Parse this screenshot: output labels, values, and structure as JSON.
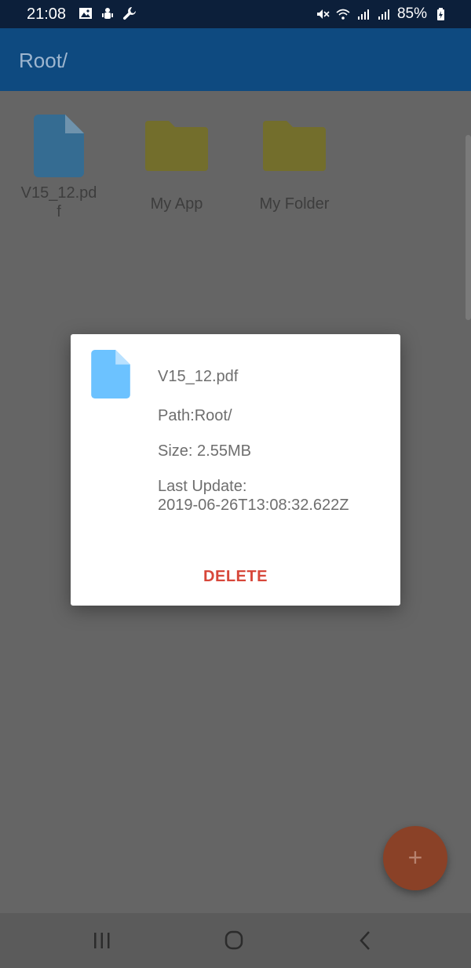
{
  "status_bar": {
    "time": "21:08",
    "battery": "85%",
    "left_icons": [
      "image-icon",
      "android-debug-icon",
      "wrench-icon"
    ],
    "right_icons": [
      "mute-icon",
      "wifi-icon",
      "signal-icon",
      "signal-roaming-icon",
      "battery-charging-icon"
    ]
  },
  "app_bar": {
    "title": "Root/"
  },
  "grid": {
    "items": [
      {
        "label": "V15_12.pd\nf",
        "icon": "file-icon"
      },
      {
        "label": "My App",
        "icon": "folder-icon"
      },
      {
        "label": "My Folder",
        "icon": "folder-icon"
      }
    ]
  },
  "dialog": {
    "file_name": "V15_12.pdf",
    "path": "Path:Root/",
    "size": "Size: 2.55MB",
    "last_update_label": "Last Update:",
    "last_update_value": "2019-06-26T13:08:32.622Z",
    "delete_label": "DELETE",
    "icon": "file-icon"
  },
  "fab": {
    "label": "+",
    "icon": "add-icon"
  },
  "nav_bar": {
    "buttons": [
      "recent-apps-icon",
      "home-icon",
      "back-icon"
    ]
  },
  "colors": {
    "status_bar": "#0c1f3a",
    "app_bar": "#0e4a80",
    "scrim_background": "#656565",
    "file_icon": "#6cc2ff",
    "folder_icon": "#ccc33a",
    "delete_text": "#d7473a",
    "fab": "#8a4127"
  }
}
